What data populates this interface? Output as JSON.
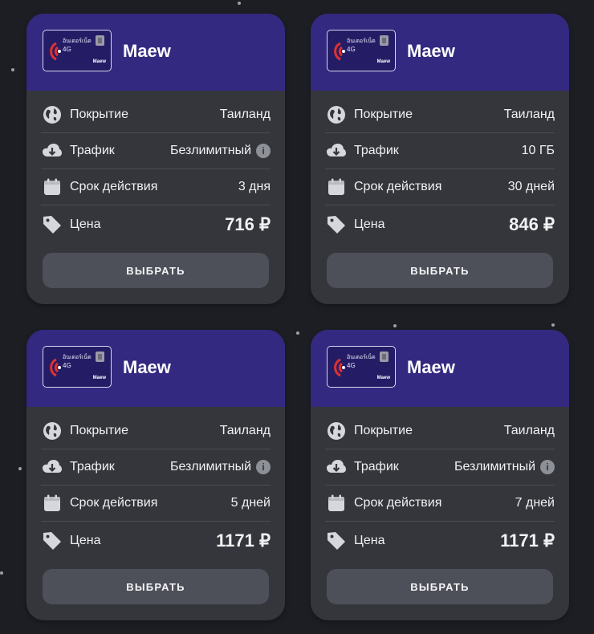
{
  "colors": {
    "background": "#1d1e24",
    "card": "#34363b",
    "header": "#332980",
    "button": "#4d5059"
  },
  "labels": {
    "coverage": "Покрытие",
    "traffic": "Трафик",
    "validity": "Срок действия",
    "price": "Цена",
    "select_button": "ВЫБРАТЬ"
  },
  "sim_card": {
    "thai_text": "อินเตอร์เน็ต",
    "network": "4G",
    "brand": "Maew"
  },
  "plans": [
    {
      "operator": "Maew",
      "coverage": "Таиланд",
      "traffic": "Безлимитный",
      "traffic_info": true,
      "validity": "3 дня",
      "price": "716 ₽"
    },
    {
      "operator": "Maew",
      "coverage": "Таиланд",
      "traffic": "10 ГБ",
      "traffic_info": false,
      "validity": "30 дней",
      "price": "846 ₽"
    },
    {
      "operator": "Maew",
      "coverage": "Таиланд",
      "traffic": "Безлимитный",
      "traffic_info": true,
      "validity": "5 дней",
      "price": "1171 ₽"
    },
    {
      "operator": "Maew",
      "coverage": "Таиланд",
      "traffic": "Безлимитный",
      "traffic_info": true,
      "validity": "7 дней",
      "price": "1171 ₽"
    }
  ],
  "icons": [
    "globe-icon",
    "cloud-download-icon",
    "calendar-icon",
    "price-tag-icon",
    "info-icon"
  ]
}
